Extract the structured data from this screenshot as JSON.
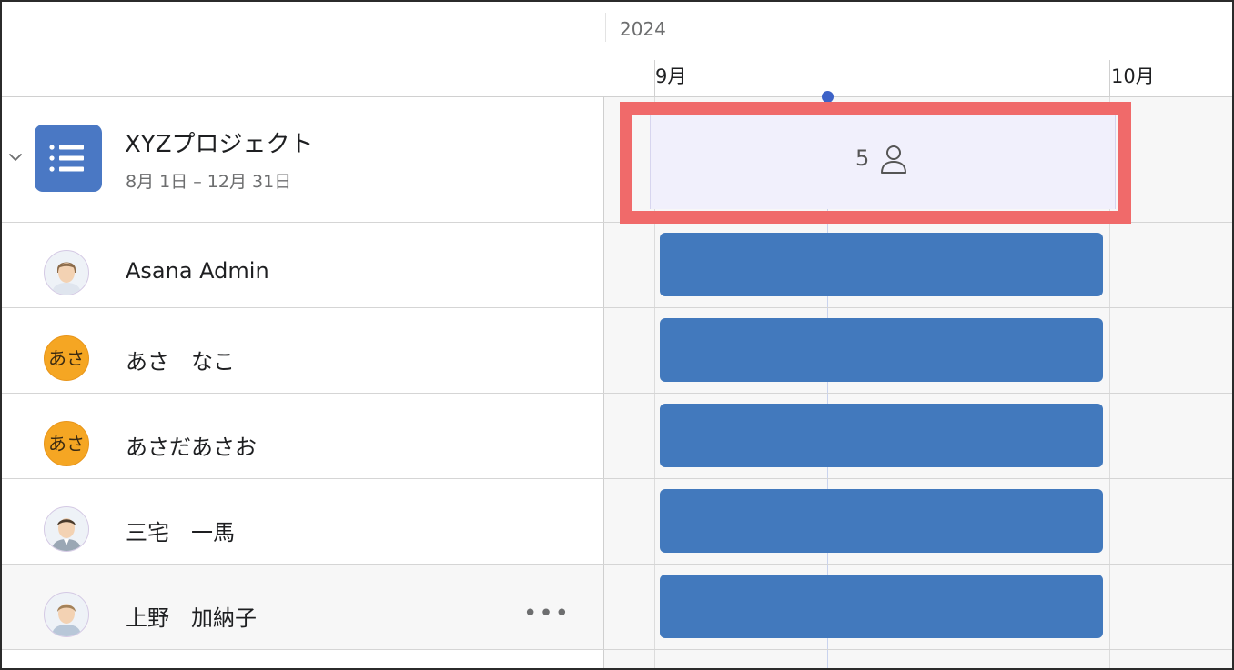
{
  "timeline": {
    "year": "2024",
    "months": [
      {
        "label": "9月"
      },
      {
        "label": "10月"
      }
    ]
  },
  "project": {
    "title": "XYZプロジェクト",
    "dates": "8月 1日 – 12月 31日",
    "member_count": "5",
    "icon": "list-icon",
    "color": "#4a78c4"
  },
  "members": [
    {
      "name": "Asana Admin",
      "avatar": "photo"
    },
    {
      "name": "あさ　なこ",
      "avatar": "initials",
      "initials": "あさ"
    },
    {
      "name": "あさだあさお",
      "avatar": "initials",
      "initials": "あさ"
    },
    {
      "name": "三宅　一馬",
      "avatar": "photo"
    },
    {
      "name": "上野　加納子",
      "avatar": "photo"
    }
  ],
  "colors": {
    "bar": "#4279bd",
    "highlight": "#f06a6a",
    "today": "#3d62c7",
    "initials_avatar": "#f5a623"
  }
}
